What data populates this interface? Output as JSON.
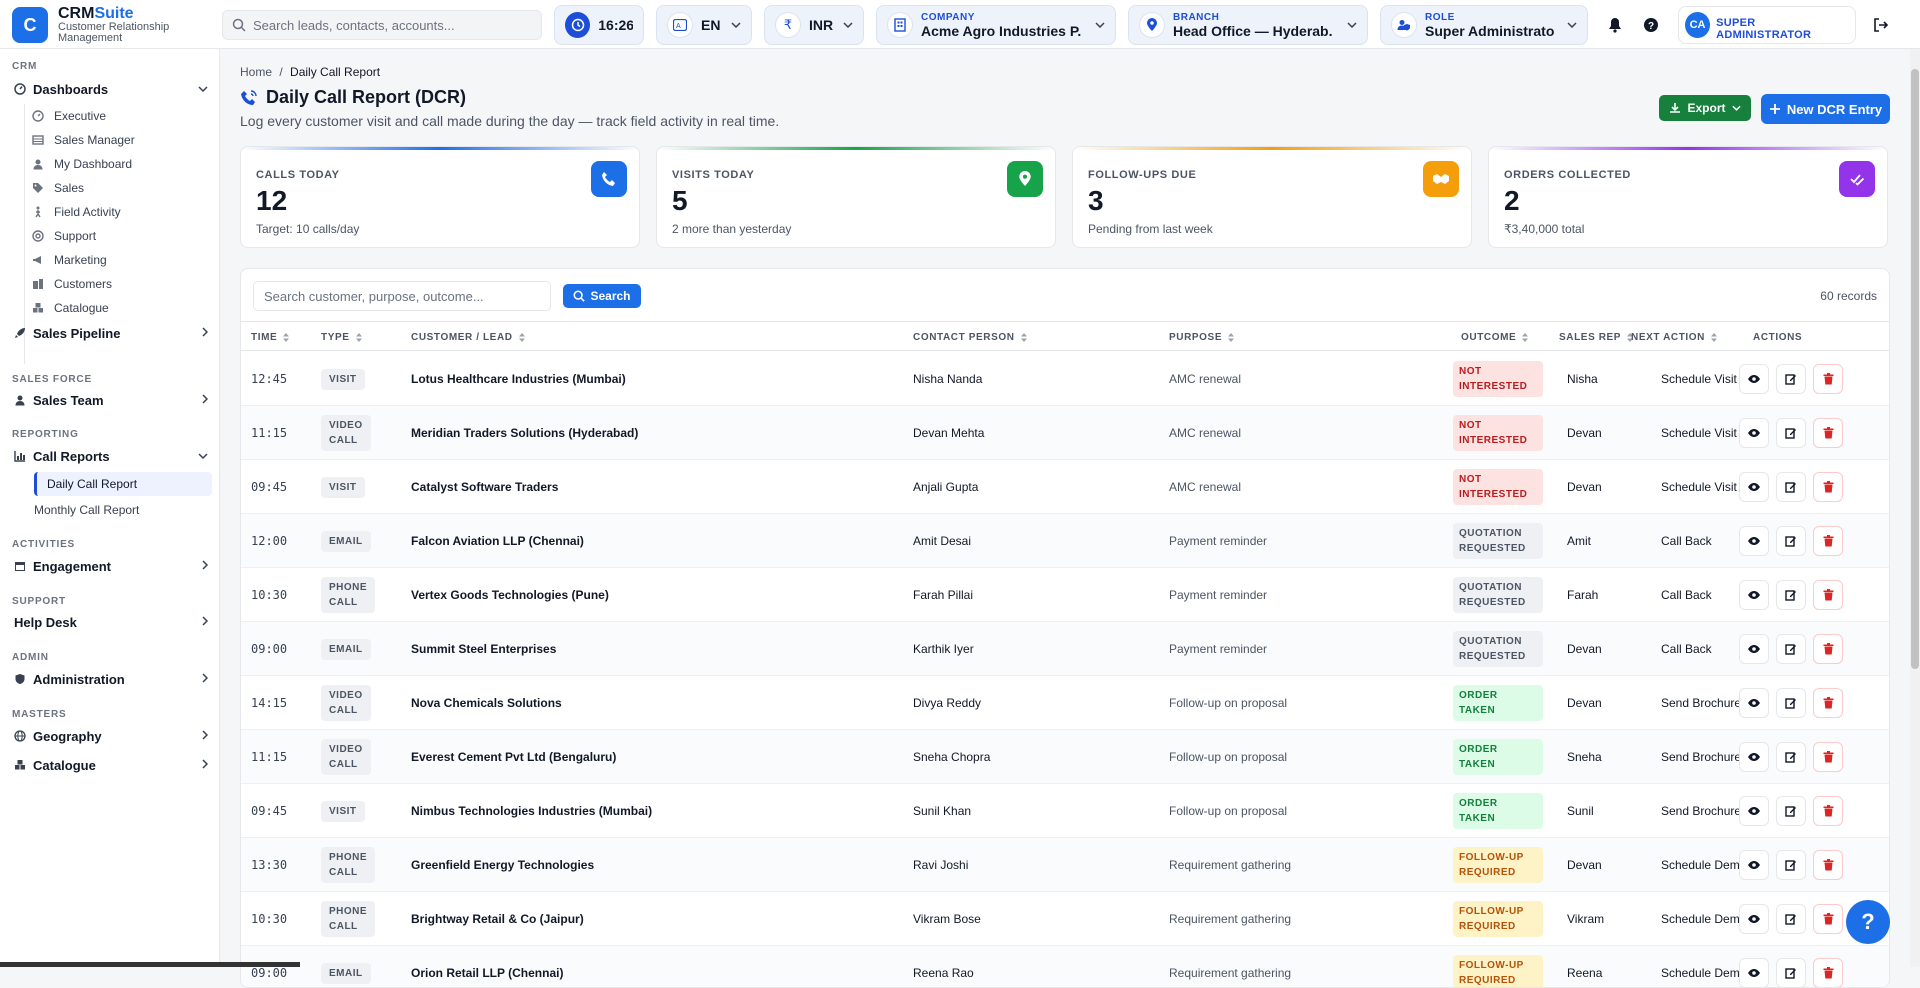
{
  "brand": {
    "logo_letter": "C",
    "name_a": "CRM",
    "name_b": "Suite",
    "tagline": "Customer Relationship Management"
  },
  "topbar": {
    "search_placeholder": "Search leads, contacts, accounts...",
    "time": "16:26",
    "language": "EN",
    "currency_symbol": "₹",
    "currency": "INR",
    "company_label": "COMPANY",
    "company_value": "Acme Agro Industries P...",
    "branch_label": "BRANCH",
    "branch_value": "Head Office — Hyderab...",
    "role_label": "ROLE",
    "role_value": "Super Administrator",
    "user_initials": "CA",
    "user_role": "SUPER ADMINISTRATOR"
  },
  "sidebar": {
    "sec_crm": "CRM",
    "dashboards": "Dashboards",
    "dash_items": [
      "Executive",
      "Sales Manager",
      "My Dashboard",
      "Sales",
      "Field Activity",
      "Support",
      "Marketing",
      "Customers",
      "Catalogue"
    ],
    "sales_pipeline": "Sales Pipeline",
    "sec_salesforce": "SALES FORCE",
    "sales_team": "Sales Team",
    "sec_reporting": "REPORTING",
    "call_reports": "Call Reports",
    "daily_call_report": "Daily Call Report",
    "monthly_call_report": "Monthly Call Report",
    "sec_activities": "ACTIVITIES",
    "engagement": "Engagement",
    "sec_support": "SUPPORT",
    "help_desk": "Help Desk",
    "sec_admin": "ADMIN",
    "administration": "Administration",
    "sec_masters": "MASTERS",
    "geography": "Geography",
    "catalogue": "Catalogue"
  },
  "page": {
    "crumb_home": "Home",
    "crumb_sep": "/",
    "crumb_current": "Daily Call Report",
    "title": "Daily Call Report (DCR)",
    "subtitle": "Log every customer visit and call made during the day — track field activity in real time.",
    "export_label": "Export",
    "new_label": "New DCR Entry"
  },
  "stats": [
    {
      "label": "CALLS TODAY",
      "value": "12",
      "sub": "Target: 10 calls/day",
      "color": "#1d6fe8",
      "icon": "phone-icon"
    },
    {
      "label": "VISITS TODAY",
      "value": "5",
      "sub": "2 more than yesterday",
      "color": "#16a34a",
      "icon": "location-pin-icon"
    },
    {
      "label": "FOLLOW-UPS DUE",
      "value": "3",
      "sub": "Pending from last week",
      "color": "#f59e0b",
      "icon": "handshake-icon"
    },
    {
      "label": "ORDERS COLLECTED",
      "value": "2",
      "sub": "₹3,40,000 total",
      "color": "#9333ea",
      "icon": "check-list-icon"
    }
  ],
  "table": {
    "search_placeholder": "Search customer, purpose, outcome...",
    "search_button": "Search",
    "records": "60 records",
    "headers": [
      "TIME",
      "TYPE",
      "CUSTOMER / LEAD",
      "CONTACT PERSON",
      "PURPOSE",
      "OUTCOME",
      "SALES REP",
      "NEXT ACTION",
      "ACTIONS"
    ],
    "rows": [
      {
        "time": "12:45",
        "type": "VISIT",
        "customer": "Lotus Healthcare Industries (Mumbai)",
        "contact": "Nisha Nanda",
        "purpose": "AMC renewal",
        "outcome": "NOT INTERESTED",
        "rep": "Nisha",
        "next": "Schedule Visit"
      },
      {
        "time": "11:15",
        "type": "VIDEO CALL",
        "customer": "Meridian Traders Solutions (Hyderabad)",
        "contact": "Devan Mehta",
        "purpose": "AMC renewal",
        "outcome": "NOT INTERESTED",
        "rep": "Devan",
        "next": "Schedule Visit"
      },
      {
        "time": "09:45",
        "type": "VISIT",
        "customer": "Catalyst Software Traders",
        "contact": "Anjali Gupta",
        "purpose": "AMC renewal",
        "outcome": "NOT INTERESTED",
        "rep": "Devan",
        "next": "Schedule Visit"
      },
      {
        "time": "12:00",
        "type": "EMAIL",
        "customer": "Falcon Aviation LLP (Chennai)",
        "contact": "Amit Desai",
        "purpose": "Payment reminder",
        "outcome": "QUOTATION REQUESTED",
        "rep": "Amit",
        "next": "Call Back"
      },
      {
        "time": "10:30",
        "type": "PHONE CALL",
        "customer": "Vertex Goods Technologies (Pune)",
        "contact": "Farah Pillai",
        "purpose": "Payment reminder",
        "outcome": "QUOTATION REQUESTED",
        "rep": "Farah",
        "next": "Call Back"
      },
      {
        "time": "09:00",
        "type": "EMAIL",
        "customer": "Summit Steel Enterprises",
        "contact": "Karthik Iyer",
        "purpose": "Payment reminder",
        "outcome": "QUOTATION REQUESTED",
        "rep": "Devan",
        "next": "Call Back"
      },
      {
        "time": "14:15",
        "type": "VIDEO CALL",
        "customer": "Nova Chemicals Solutions",
        "contact": "Divya Reddy",
        "purpose": "Follow-up on proposal",
        "outcome": "ORDER TAKEN",
        "rep": "Devan",
        "next": "Send Brochure"
      },
      {
        "time": "11:15",
        "type": "VIDEO CALL",
        "customer": "Everest Cement Pvt Ltd (Bengaluru)",
        "contact": "Sneha Chopra",
        "purpose": "Follow-up on proposal",
        "outcome": "ORDER TAKEN",
        "rep": "Sneha",
        "next": "Send Brochure"
      },
      {
        "time": "09:45",
        "type": "VISIT",
        "customer": "Nimbus Technologies Industries (Mumbai)",
        "contact": "Sunil Khan",
        "purpose": "Follow-up on proposal",
        "outcome": "ORDER TAKEN",
        "rep": "Sunil",
        "next": "Send Brochure"
      },
      {
        "time": "13:30",
        "type": "PHONE CALL",
        "customer": "Greenfield Energy Technologies",
        "contact": "Ravi Joshi",
        "purpose": "Requirement gathering",
        "outcome": "FOLLOW-UP REQUIRED",
        "rep": "Devan",
        "next": "Schedule Demo"
      },
      {
        "time": "10:30",
        "type": "PHONE CALL",
        "customer": "Brightway Retail & Co (Jaipur)",
        "contact": "Vikram Bose",
        "purpose": "Requirement gathering",
        "outcome": "FOLLOW-UP REQUIRED",
        "rep": "Vikram",
        "next": "Schedule Demo"
      },
      {
        "time": "09:00",
        "type": "EMAIL",
        "customer": "Orion Retail LLP (Chennai)",
        "contact": "Reena Rao",
        "purpose": "Requirement gathering",
        "outcome": "FOLLOW-UP REQUIRED",
        "rep": "Reena",
        "next": "Schedule Demo"
      }
    ]
  },
  "outcome_colors": {
    "NOT INTERESTED": {
      "bg": "#fde2e2",
      "fg": "#b91c1c"
    },
    "QUOTATION REQUESTED": {
      "bg": "#eef0f3",
      "fg": "#4b5563"
    },
    "ORDER TAKEN": {
      "bg": "#dcfce7",
      "fg": "#15803d"
    },
    "FOLLOW-UP REQUIRED": {
      "bg": "#fef3c7",
      "fg": "#b45309"
    }
  },
  "help_label": "?"
}
